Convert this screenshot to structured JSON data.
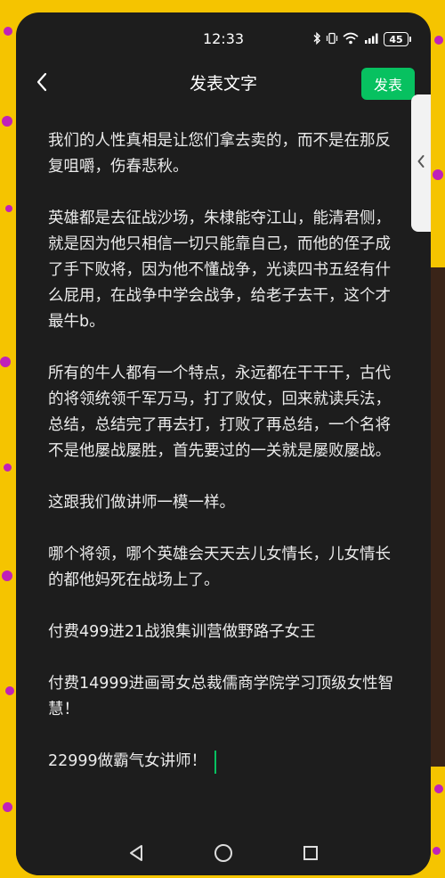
{
  "status_bar": {
    "time": "12:33",
    "icons": [
      "bluetooth-icon",
      "vibrate-icon",
      "wifi-icon",
      "cellular-5g-icon"
    ],
    "battery": "45"
  },
  "header": {
    "title": "发表文字",
    "publish_label": "发表"
  },
  "editor": {
    "paragraphs": [
      "我们的人性真相是让您们拿去卖的，而不是在那反复咀嚼，伤春悲秋。",
      "英雄都是去征战沙场，朱棣能夺江山，能清君侧，就是因为他只相信一切只能靠自己，而他的侄子成了手下败将，因为他不懂战争，光读四书五经有什么屁用，在战争中学会战争，给老子去干，这个才最牛b。",
      "所有的牛人都有一个特点，永远都在干干干，古代的将领统领千军万马，打了败仗，回来就读兵法，总结，总结完了再去打，打败了再总结，一个名将不是他屡战屡胜，首先要过的一关就是屡败屡战。",
      "这跟我们做讲师一模一样。",
      "哪个将领，哪个英雄会天天去儿女情长，儿女情长的都他妈死在战场上了。",
      "付费499进21战狼集训营做野路子女王",
      "付费14999进画哥女总裁儒商学院学习顶级女性智慧！",
      "22999做霸气女讲师！"
    ]
  },
  "colors": {
    "background": "#1d1d1d",
    "text": "#ebebeb",
    "accent": "#07c160",
    "outer": "#f5c400",
    "dots": "#c021b8"
  },
  "nav_bar": {
    "icons": [
      "back-triangle-icon",
      "home-circle-icon",
      "recents-square-icon"
    ]
  }
}
